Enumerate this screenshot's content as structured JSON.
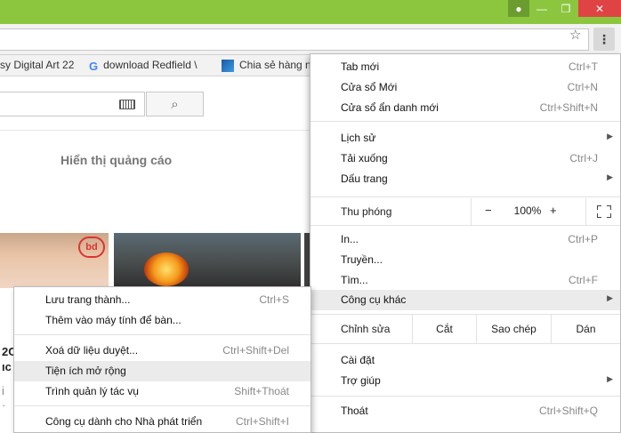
{
  "window": {
    "user_icon": "person-icon",
    "minimize_glyph": "—",
    "maximize_glyph": "❐",
    "close_glyph": "✕"
  },
  "toolbar": {
    "star_glyph": "☆",
    "menu_glyph": "⋮"
  },
  "bookmarks": [
    {
      "label": "sy Digital Art 22"
    },
    {
      "label": "download Redfield \\"
    },
    {
      "label": "Chia sẻ hàng n"
    }
  ],
  "page": {
    "search_glyph": "⌕",
    "ad_text": "Hiển thị quảng cáo",
    "thumb_logo": "bd",
    "frag1": "2C",
    "frag2": "ıc",
    "frag3": "i",
    "frag4": "·"
  },
  "menu": {
    "new_tab": {
      "label": "Tab mới",
      "shortcut": "Ctrl+T"
    },
    "new_window": {
      "label": "Cửa sổ Mới",
      "shortcut": "Ctrl+N"
    },
    "incognito": {
      "label": "Cửa sổ ẩn danh mới",
      "shortcut": "Ctrl+Shift+N"
    },
    "history": {
      "label": "Lịch sử",
      "arrow": "▶"
    },
    "downloads": {
      "label": "Tải xuống",
      "shortcut": "Ctrl+J"
    },
    "bookmarks": {
      "label": "Dấu trang",
      "arrow": "▶"
    },
    "zoom": {
      "label": "Thu phóng",
      "minus": "−",
      "value": "100%",
      "plus": "+"
    },
    "print": {
      "label": "In...",
      "shortcut": "Ctrl+P"
    },
    "cast": {
      "label": "Truyền..."
    },
    "find": {
      "label": "Tìm...",
      "shortcut": "Ctrl+F"
    },
    "more_tools": {
      "label": "Công cụ khác",
      "arrow": "▶"
    },
    "edit": {
      "label": "Chỉnh sửa",
      "cut": "Cắt",
      "copy": "Sao chép",
      "paste": "Dán"
    },
    "settings": {
      "label": "Cài đặt"
    },
    "help": {
      "label": "Trợ giúp",
      "arrow": "▶"
    },
    "exit": {
      "label": "Thoát",
      "shortcut": "Ctrl+Shift+Q"
    }
  },
  "submenu": {
    "save_page": {
      "label": "Lưu trang thành...",
      "shortcut": "Ctrl+S"
    },
    "add_desktop": {
      "label": "Thêm vào máy tính để bàn..."
    },
    "clear_data": {
      "label": "Xoá dữ liệu duyệt...",
      "shortcut": "Ctrl+Shift+Del"
    },
    "extensions": {
      "label": "Tiện ích mở rộng"
    },
    "task_manager": {
      "label": "Trình quản lý tác vụ",
      "shortcut": "Shift+Thoát"
    },
    "dev_tools": {
      "label": "Công cụ dành cho Nhà phát triển",
      "shortcut": "Ctrl+Shift+I"
    }
  }
}
